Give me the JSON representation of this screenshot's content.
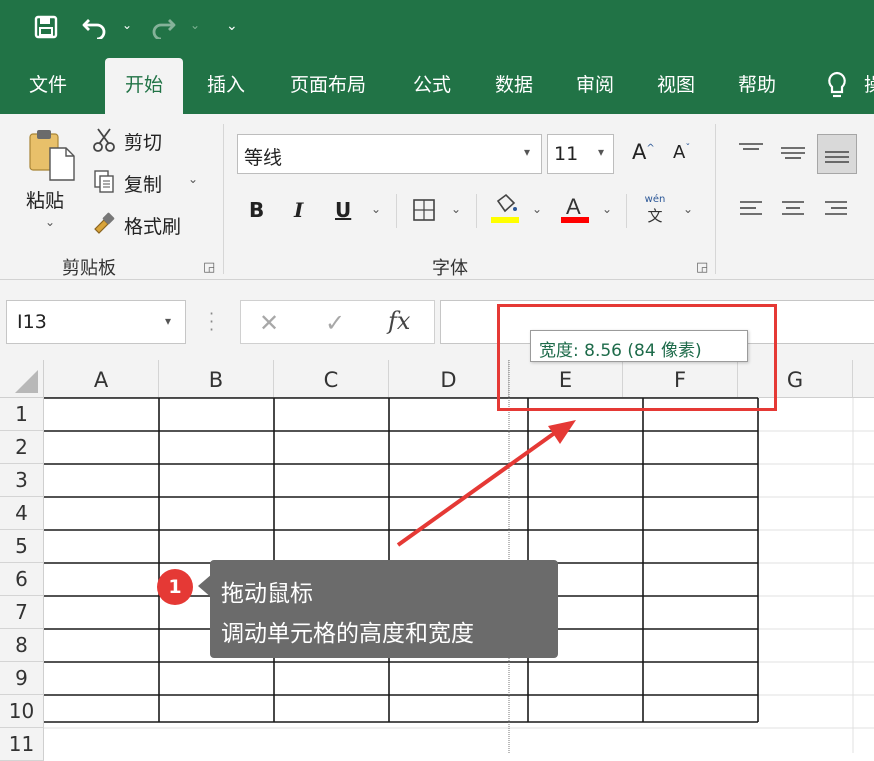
{
  "qat": {
    "save_icon": "save-icon",
    "undo_icon": "undo-icon",
    "redo_icon": "redo-icon",
    "customize_icon": "customize-qat-icon"
  },
  "tabs": {
    "items": [
      {
        "label": "文件"
      },
      {
        "label": "开始"
      },
      {
        "label": "插入"
      },
      {
        "label": "页面布局"
      },
      {
        "label": "公式"
      },
      {
        "label": "数据"
      },
      {
        "label": "审阅"
      },
      {
        "label": "视图"
      },
      {
        "label": "帮助"
      }
    ],
    "active": "开始",
    "tell_me_icon": "lightbulb-icon",
    "overflow_text": "操"
  },
  "clipboard": {
    "paste_label": "粘贴",
    "cut_label": "剪切",
    "copy_label": "复制",
    "format_painter_label": "格式刷",
    "group_label": "剪贴板"
  },
  "font": {
    "name": "等线",
    "size": "11",
    "bold": "B",
    "italic": "I",
    "underline": "U",
    "group_label": "字体",
    "phonetic_top": "wén",
    "phonetic_bottom": "文",
    "font_color": "#ff0000",
    "fill_color": "#ffff00"
  },
  "formula_bar": {
    "name_box": "I13",
    "fx_label": "fx",
    "formula": ""
  },
  "sheet": {
    "columns": [
      "A",
      "B",
      "C",
      "D",
      "E",
      "F",
      "G"
    ],
    "rows": [
      "1",
      "2",
      "3",
      "4",
      "5",
      "6",
      "7",
      "8",
      "9",
      "10",
      "11"
    ],
    "width_tooltip": "宽度: 8.56 (84 像素)"
  },
  "callout": {
    "number": "1",
    "line1": "拖动鼠标",
    "line2": "调动单元格的高度和宽度"
  },
  "colors": {
    "brand": "#217346",
    "annotation_red": "#e53935",
    "callout_bg": "#6b6b6b"
  }
}
